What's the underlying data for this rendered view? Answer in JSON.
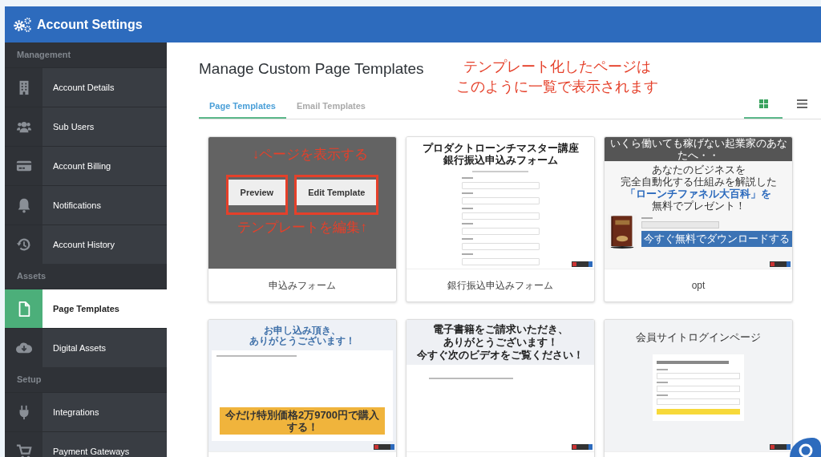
{
  "header": {
    "title": "Account Settings"
  },
  "sidebar": {
    "sections": [
      {
        "heading": "Management",
        "items": [
          {
            "label": "Account Details",
            "selected": false
          },
          {
            "label": "Sub Users",
            "selected": false
          },
          {
            "label": "Account Billing",
            "selected": false
          },
          {
            "label": "Notifications",
            "selected": false
          },
          {
            "label": "Account History",
            "selected": false
          }
        ]
      },
      {
        "heading": "Assets",
        "items": [
          {
            "label": "Page Templates",
            "selected": true
          },
          {
            "label": "Digital Assets",
            "selected": false
          }
        ]
      },
      {
        "heading": "Setup",
        "items": [
          {
            "label": "Integrations",
            "selected": false
          },
          {
            "label": "Payment Gateways",
            "selected": false
          }
        ]
      }
    ]
  },
  "main": {
    "title": "Manage Custom Page Templates",
    "annotation": [
      "テンプレート化したページは",
      "このように一覧で表示されます"
    ],
    "tabs": [
      {
        "label": "Page Templates",
        "selected": true
      },
      {
        "label": "Email Templates",
        "selected": false
      }
    ],
    "view_buttons": [
      {
        "selected": true
      },
      {
        "selected": false
      }
    ],
    "templates": [
      {
        "name": "申込みフォーム",
        "hovered": true,
        "buttons": [
          "Preview",
          "Edit Template"
        ],
        "notes": [
          "↓ページを表示する",
          "テンプレートを編集↑"
        ],
        "preview": {
          "kind": "blank"
        }
      },
      {
        "name": "銀行振込申込みフォーム",
        "hovered": false,
        "preview": {
          "kind": "form",
          "heading": [
            "プロダクトローンチマスター講座",
            "銀行振込申込みフォーム"
          ]
        }
      },
      {
        "name": "opt",
        "hovered": false,
        "preview": {
          "kind": "optin",
          "banner": "いくら働いても稼げない起業家のあなたへ・・",
          "headline": [
            "あなたのビジネスを",
            "完全自動化する仕組みを解説した",
            "「ローンチファネル大百科」を",
            "無料でプレゼント！"
          ],
          "button": "今すぐ無料でダウンロードする"
        }
      },
      {
        "hovered": false,
        "preview": {
          "kind": "thanks_offer",
          "heading": [
            "お申し込み頂き、",
            "ありがとうございます！"
          ],
          "button": "今だけ特別価格2万9700円で購入する！"
        }
      },
      {
        "hovered": false,
        "preview": {
          "kind": "thanks_video",
          "heading": [
            "電子書籍をご請求いただき、",
            "ありがとうございます！",
            "今すぐ次のビデオをご覧ください！"
          ]
        }
      },
      {
        "hovered": false,
        "preview": {
          "kind": "login",
          "heading": [
            "会員サイトログインページ"
          ]
        }
      }
    ]
  }
}
